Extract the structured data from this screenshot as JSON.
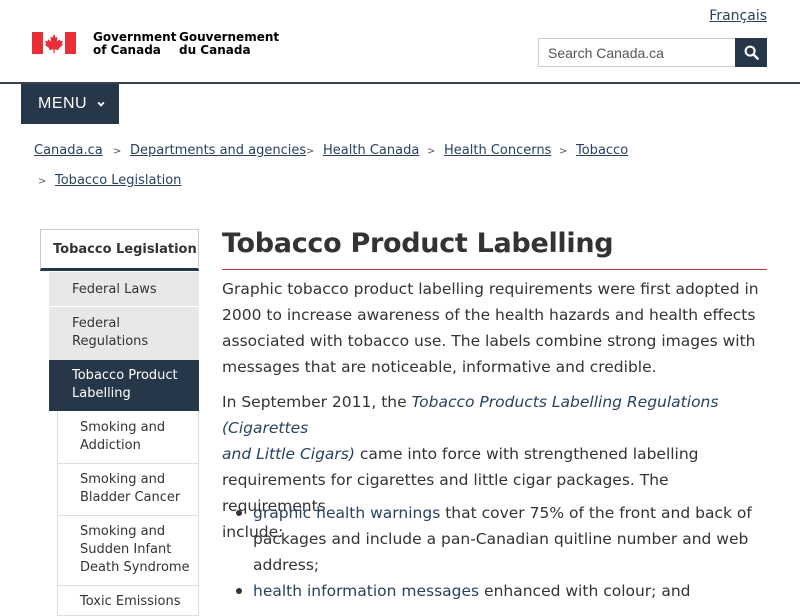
{
  "header": {
    "language_link": "Français",
    "signature_en_line1": "Government",
    "signature_en_line2": "of Canada",
    "signature_fr_line1": "Gouvernement",
    "signature_fr_line2": "du Canada",
    "search_placeholder": "Search Canada.ca",
    "menu_label": "MENU"
  },
  "colors": {
    "brand_dark": "#26374a",
    "link": "#284162",
    "flag_red": "#eb2d37",
    "title_rule": "#af3c43"
  },
  "breadcrumb": [
    "Canada.ca",
    "Departments and agencies",
    "Health Canada",
    "Health Concerns",
    "Tobacco",
    "Tobacco Legislation"
  ],
  "sidenav": {
    "heading": "Tobacco Legislation",
    "items": [
      {
        "line1": "Federal Laws",
        "line2": "",
        "line3": ""
      },
      {
        "line1": "Federal",
        "line2": "Regulations",
        "line3": ""
      },
      {
        "line1": "Tobacco Product",
        "line2": "Labelling",
        "line3": ""
      },
      {
        "line1": "Smoking and",
        "line2": "Addiction",
        "line3": ""
      },
      {
        "line1": "Smoking and",
        "line2": "Bladder Cancer",
        "line3": ""
      },
      {
        "line1": "Smoking and",
        "line2": "Sudden Infant",
        "line3": "Death Syndrome"
      },
      {
        "line1": "Toxic Emissions",
        "line2": "",
        "line3": ""
      }
    ]
  },
  "main": {
    "title": "Tobacco Product Labelling",
    "para1": {
      "l1": "Graphic tobacco product labelling requirements were first adopted in",
      "l2": "2000 to increase awareness of the health hazards and health effects",
      "l3": "associated with tobacco use. The labels combine strong images with",
      "l4": "messages that are noticeable, informative and credible."
    },
    "para2": {
      "l1_pre": "In September 2011, the ",
      "l1_link": "Tobacco Products Labelling Regulations (Cigarettes",
      "l2_link": "and Little Cigars)",
      "l2_post": " came into force with strengthened labelling",
      "l3": "requirements for cigarettes and little cigar packages. The requirements",
      "l4": "include:"
    },
    "bullets": [
      {
        "link": "graphic health warnings",
        "l1_post": " that cover 75% of the front and back of",
        "l2": "packages and include a pan-Canadian quitline number and web",
        "l3": "address;"
      },
      {
        "link": "health information messages",
        "l1_post": " enhanced with colour; and",
        "l2": "",
        "l3": ""
      }
    ]
  }
}
